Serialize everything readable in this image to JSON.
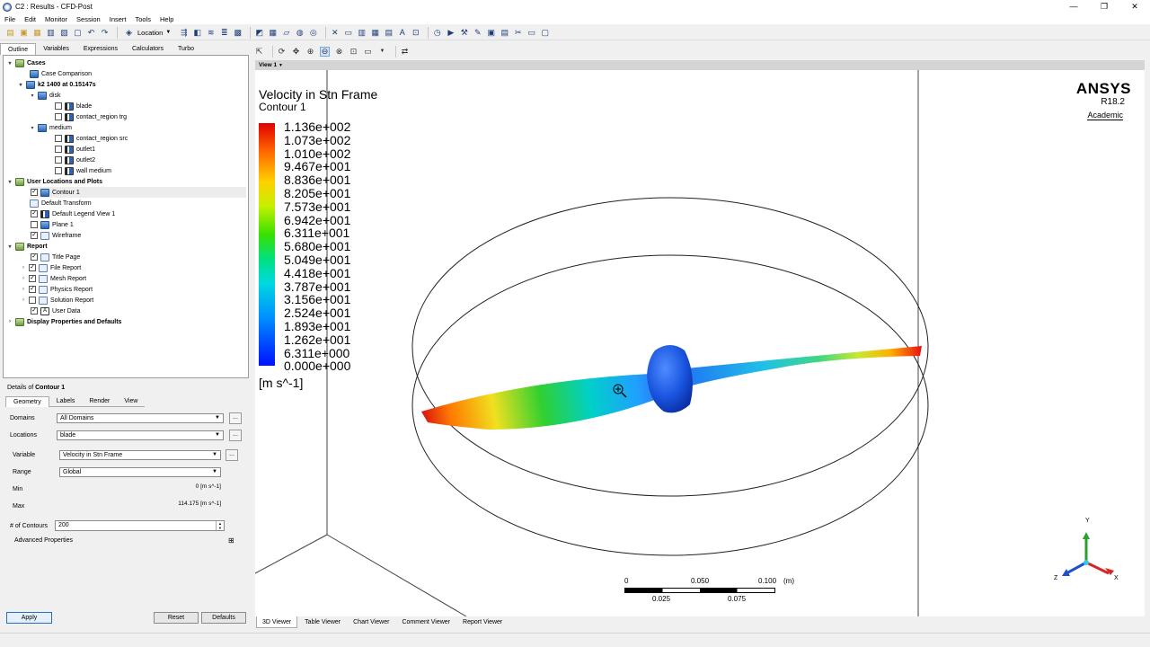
{
  "window": {
    "title": "C2 : Results - CFD-Post",
    "minimize": "—",
    "maximize": "❐",
    "close": "✕"
  },
  "menu": [
    "File",
    "Edit",
    "Monitor",
    "Session",
    "Insert",
    "Tools",
    "Help"
  ],
  "toolbar": {
    "location_label": "Location"
  },
  "left_tabs": [
    "Outline",
    "Variables",
    "Expressions",
    "Calculators",
    "Turbo"
  ],
  "tree": {
    "cases": "Cases",
    "case_comparison": "Case Comparison",
    "case_name": "k2 1400 at 0.15147s",
    "disk": "disk",
    "blade": "blade",
    "contact_trg": "contact_region trg",
    "medium": "medium",
    "contact_src": "contact_region src",
    "outlet1": "outlet1",
    "outlet2": "outlet2",
    "wall_medium": "wall medium",
    "user_locations": "User Locations and Plots",
    "contour1": "Contour 1",
    "default_transform": "Default Transform",
    "default_legend": "Default Legend View 1",
    "plane1": "Plane 1",
    "wireframe": "Wireframe",
    "report": "Report",
    "title_page": "Title Page",
    "file_report": "File Report",
    "mesh_report": "Mesh Report",
    "physics_report": "Physics Report",
    "solution_report": "Solution Report",
    "user_data": "User Data",
    "display_props": "Display Properties and Defaults"
  },
  "details": {
    "title_prefix": "Details of ",
    "title_object": "Contour 1",
    "tabs": [
      "Geometry",
      "Labels",
      "Render",
      "View"
    ],
    "domains_label": "Domains",
    "domains_value": "All Domains",
    "locations_label": "Locations",
    "locations_value": "blade",
    "variable_label": "Variable",
    "variable_value": "Velocity in Stn Frame",
    "range_label": "Range",
    "range_value": "Global",
    "min_label": "Min",
    "min_value": "0 [m s^-1]",
    "max_label": "Max",
    "max_value": "114.175 [m s^-1]",
    "contours_label": "# of Contours",
    "contours_value": "200",
    "advanced": "Advanced Properties",
    "apply": "Apply",
    "reset": "Reset",
    "defaults": "Defaults"
  },
  "viewer": {
    "view_label": "View 1",
    "title": "Velocity in Stn Frame",
    "subtitle": "Contour 1",
    "legend": [
      "1.136e+002",
      "1.073e+002",
      "1.010e+002",
      "9.467e+001",
      "8.836e+001",
      "8.205e+001",
      "7.573e+001",
      "6.942e+001",
      "6.311e+001",
      "5.680e+001",
      "5.049e+001",
      "4.418e+001",
      "3.787e+001",
      "3.156e+001",
      "2.524e+001",
      "1.893e+001",
      "1.262e+001",
      "6.311e+000",
      "0.000e+000"
    ],
    "units": "[m s^-1]",
    "logo": "ANSYS",
    "version": "R18.2",
    "edition": "Academic",
    "scale": {
      "t0": "0",
      "t1": "0.050",
      "t2": "0.100",
      "unit": "(m)",
      "b1": "0.025",
      "b2": "0.075"
    },
    "axes": {
      "x": "X",
      "y": "Y",
      "z": "Z"
    }
  },
  "bottom_tabs": [
    "3D Viewer",
    "Table Viewer",
    "Chart Viewer",
    "Comment Viewer",
    "Report Viewer"
  ]
}
